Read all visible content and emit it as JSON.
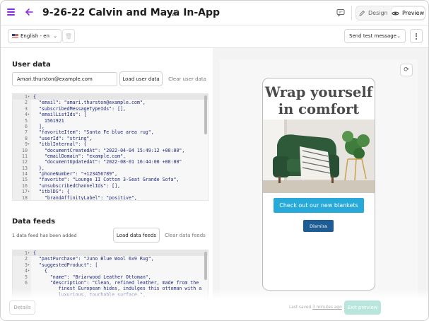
{
  "header": {
    "title": "9-26-22 Calvin and Maya In-App",
    "design_label": "Design",
    "preview_label": "Preview"
  },
  "toolbar": {
    "language": "English - en",
    "send_test_label": "Send test message"
  },
  "user_data": {
    "heading": "User data",
    "email_value": "Amari.thurston@example.com",
    "load_label": "Load user data",
    "clear_label": "Clear user data",
    "code_lines": [
      {
        "n": "1",
        "fold": "▾",
        "text": "{"
      },
      {
        "n": "2",
        "fold": "",
        "text": "  \"email\": \"amari.thurston@example.com\","
      },
      {
        "n": "3",
        "fold": "",
        "text": "  \"subscribedMessageTypeIds\": [],"
      },
      {
        "n": "4",
        "fold": "▾",
        "text": "  \"emailListIds\": ["
      },
      {
        "n": "5",
        "fold": "",
        "text": "    1561921"
      },
      {
        "n": "6",
        "fold": "",
        "text": "  ],"
      },
      {
        "n": "7",
        "fold": "",
        "text": "  \"favoriteItem\": \"Santa Fe blue area rug\","
      },
      {
        "n": "8",
        "fold": "",
        "text": "  \"userId\": \"string\","
      },
      {
        "n": "9",
        "fold": "▾",
        "text": "  \"itblInternal\": {"
      },
      {
        "n": "10",
        "fold": "",
        "text": "    \"documentCreatedAt\": \"2022-04-04 15:49:12 +00:00\","
      },
      {
        "n": "11",
        "fold": "",
        "text": "    \"emailDomain\": \"example.com\","
      },
      {
        "n": "12",
        "fold": "",
        "text": "    \"documentUpdatedAt\": \"2022-08-01 16:44:00 +00:00\""
      },
      {
        "n": "13",
        "fold": "",
        "text": "  },"
      },
      {
        "n": "14",
        "fold": "",
        "text": "  \"phoneNumber\": \"+123456789\","
      },
      {
        "n": "15",
        "fold": "",
        "text": "  \"favorite\": \"Lounge II Cotton 3-Seat Grande Sofa\","
      },
      {
        "n": "16",
        "fold": "",
        "text": "  \"unsubscribedChannelIds\": [],"
      },
      {
        "n": "17",
        "fold": "▾",
        "text": "  \"itblDS\": {"
      },
      {
        "n": "18",
        "fold": "",
        "text": "    \"brandAffinityLabel\": \"positive\","
      }
    ]
  },
  "data_feeds": {
    "heading": "Data feeds",
    "note": "1 data feed has been added",
    "load_label": "Load data feeds",
    "clear_label": "Clear data feeds",
    "code_lines": [
      {
        "n": "1",
        "fold": "▾",
        "text": "{"
      },
      {
        "n": "2",
        "fold": "",
        "text": "  \"pastPurchase\": \"Juno Blue Wool 6x9 Rug\","
      },
      {
        "n": "3",
        "fold": "▾",
        "text": "  \"suggestedProduct\": ["
      },
      {
        "n": "4",
        "fold": "▾",
        "text": "    {"
      },
      {
        "n": "5",
        "fold": "",
        "text": "      \"name\": \"Briarwood Leather Ottoman\","
      },
      {
        "n": "6",
        "fold": "",
        "text": "      \"description\": \"Clean, refined leather, made from the"
      },
      {
        "n": "",
        "fold": "",
        "text": "         finest European hides, indulges this ottoman with a"
      },
      {
        "n": "",
        "fold": "",
        "text": "         luxurious, touchable surface.\","
      }
    ]
  },
  "preview": {
    "headline_line1": "Wrap yourself",
    "headline_line2": "in comfort",
    "cta_label": "Check out our new blankets",
    "dismiss_label": "Dismiss"
  },
  "footer": {
    "details_label": "Details",
    "saved_prefix": "Last saved",
    "saved_ago": "3 minutes ago",
    "exit_label": "Exit preview"
  },
  "colors": {
    "accent": "#8a2be2",
    "cta": "#27a9d9",
    "dismiss": "#1e5c94",
    "exit": "#b8e6dc"
  }
}
